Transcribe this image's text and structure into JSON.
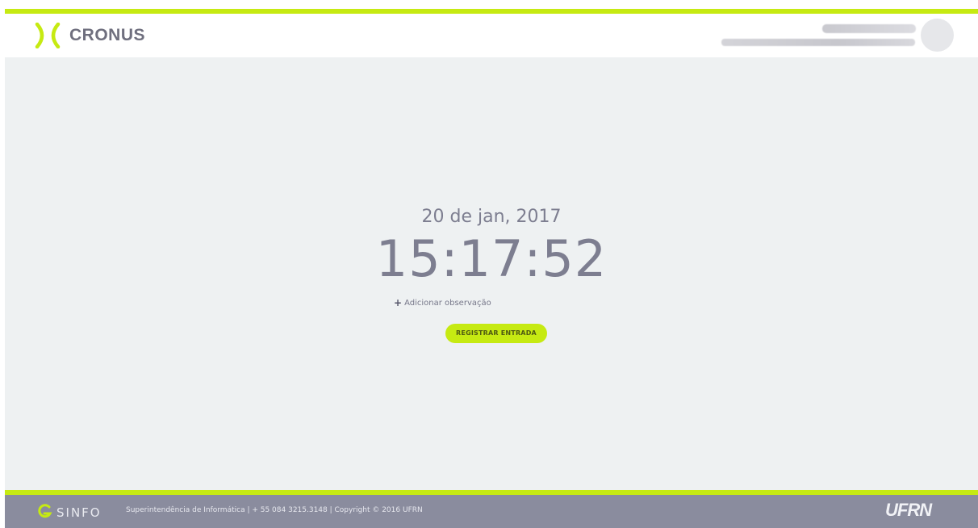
{
  "app": {
    "name": "CRONUS"
  },
  "header": {
    "user_name_obscured": "",
    "user_details_obscured": ""
  },
  "clock": {
    "date": "20 de jan, 2017",
    "time": "15:17:52"
  },
  "actions": {
    "add_note_icon": "+",
    "add_note_label": "Adicionar observação",
    "register_label": "REGISTRAR ENTRADA"
  },
  "footer": {
    "sinfo_label": "SINFO",
    "info_text": "Superintendência de Informática  |  + 55 084 3215.3148  |  Copyright © 2016  UFRN",
    "ufrn_label": "UFRN"
  },
  "colors": {
    "accent": "#c6ea12",
    "background": "#eef1f2",
    "text": "#7d7e90",
    "footer": "#8a8c9e"
  },
  "icons": {
    "logo": "cronus-logo-icon",
    "sinfo": "sinfo-logo-icon",
    "avatar": "user-avatar"
  }
}
